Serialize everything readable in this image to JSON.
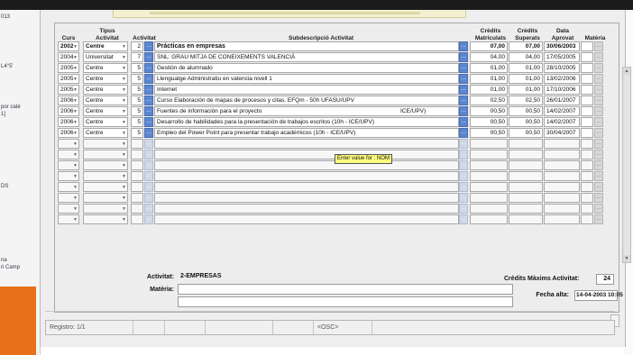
{
  "left_pane": {
    "labels": [
      "013",
      "L4°5'",
      "por caté",
      "1]",
      "DS",
      "na",
      "ri Camp"
    ]
  },
  "headers": {
    "curs": "Curs",
    "tipus": "Tipus Activitat",
    "activitat": "Activitat",
    "subdescripcio": "Subdescripció Activitat",
    "credits_matriculats": "Crèdits Matriculats",
    "credits_superats": "Crèdits Superats",
    "data_aprovat": "Data Aprovat",
    "materia": "Matèria"
  },
  "rows": [
    {
      "curs": "2002",
      "tipus": "Centre",
      "act": "2",
      "desc": "Prácticas en empresas",
      "cmat": "07,00",
      "csup": "07,00",
      "data": "30/06/2003",
      "bold": true
    },
    {
      "curs": "2004",
      "tipus": "Universitat",
      "act": "7",
      "desc": "SNL: GRAU MITJA DE CONEIXEMENTS VALENCIÀ",
      "cmat": "04,00",
      "csup": "04,00",
      "data": "17/05/2005",
      "bold": false
    },
    {
      "curs": "2005",
      "tipus": "Centre",
      "act": "5",
      "desc": "Gestión de alumnado",
      "cmat": "01,00",
      "csup": "01,00",
      "data": "28/10/2005",
      "bold": false
    },
    {
      "curs": "2005",
      "tipus": "Centre",
      "act": "5",
      "desc": "Llenguatge Administratiu en valencia nivell 1",
      "cmat": "01,00",
      "csup": "01,00",
      "data": "13/02/2006",
      "bold": false
    },
    {
      "curs": "2005",
      "tipus": "Centre",
      "act": "5",
      "desc": "Internet",
      "cmat": "01,00",
      "csup": "01,00",
      "data": "17/10/2006",
      "bold": false
    },
    {
      "curs": "2006",
      "tipus": "Centre",
      "act": "5",
      "desc": "Curso Elaboración de mapas de procesos y citas. EFQm - 50h UFASU/UPV",
      "cmat": "02,50",
      "csup": "02,50",
      "data": "26/01/2007",
      "bold": false
    },
    {
      "curs": "2006",
      "tipus": "Centre",
      "act": "5",
      "desc": "Fuentes de información para el proyecto",
      "desc_tail": "ICE/UPV)",
      "cmat": "00,50",
      "csup": "00,50",
      "data": "14/02/2007",
      "bold": false
    },
    {
      "curs": "2006",
      "tipus": "Centre",
      "act": "5",
      "desc": "Desarrollo de habilidades para la presentación de trabajos escritos (10h - ICE/UPV)",
      "cmat": "00,50",
      "csup": "00,50",
      "data": "14/02/2007",
      "bold": false
    },
    {
      "curs": "2006",
      "tipus": "Centre",
      "act": "5",
      "desc": "Empleo del Power Point para presentar trabajo académicos (10h - ICE/UPV)",
      "cmat": "00,50",
      "csup": "00,50",
      "data": "30/04/2007",
      "bold": false
    }
  ],
  "empty_rows": 8,
  "tooltip": "Enter value for : NOM",
  "detail": {
    "activitat_label": "Activitat:",
    "activitat_value": "2-EMPRESAS",
    "materia_label": "Matèria:",
    "credits_max_label": "Crèdits Màxims Activitat:",
    "credits_max_value": "24",
    "fecha_alta_label": "Fecha alta:",
    "fecha_alta_value": "14-04-2003 10:05"
  },
  "status": {
    "registro": "Registro: 1/1",
    "osc": "<OSC>"
  },
  "icons": {
    "lov": "list-of-values-icon",
    "dropdown": "chevron-down-icon"
  }
}
